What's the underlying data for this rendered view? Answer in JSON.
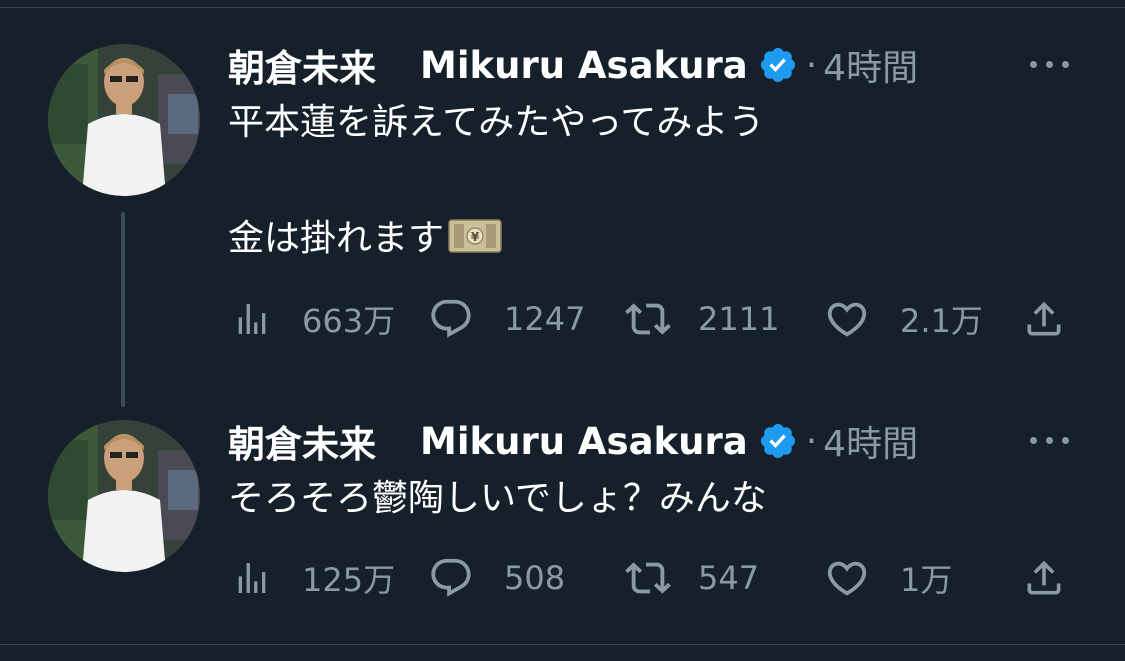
{
  "tweets": [
    {
      "display_name": "朝倉未来",
      "handle_name": "Mikuru Asakura",
      "dot": "·",
      "time": "4時間",
      "lines": [
        "平本蓮を訴えてみたやってみよう",
        "",
        "金は掛れます"
      ],
      "emoji": "money-with-wings",
      "stats": {
        "views": "663万",
        "replies": "1247",
        "retweets": "2111",
        "likes": "2.1万"
      }
    },
    {
      "display_name": "朝倉未来",
      "handle_name": "Mikuru Asakura",
      "dot": "·",
      "time": "4時間",
      "lines": [
        "そろそろ鬱陶しいでしょ？みんな"
      ],
      "stats": {
        "views": "125万",
        "replies": "508",
        "retweets": "547",
        "likes": "1万"
      }
    }
  ],
  "colors": {
    "background": "#15202b",
    "text": "#ffffff",
    "muted": "#8b98a5",
    "verified": "#1d9bf0",
    "thread_line": "#3d4a56"
  },
  "icons": [
    "analytics-icon",
    "reply-icon",
    "retweet-icon",
    "like-icon",
    "share-icon",
    "verified-badge-icon",
    "more-icon",
    "money-icon"
  ]
}
